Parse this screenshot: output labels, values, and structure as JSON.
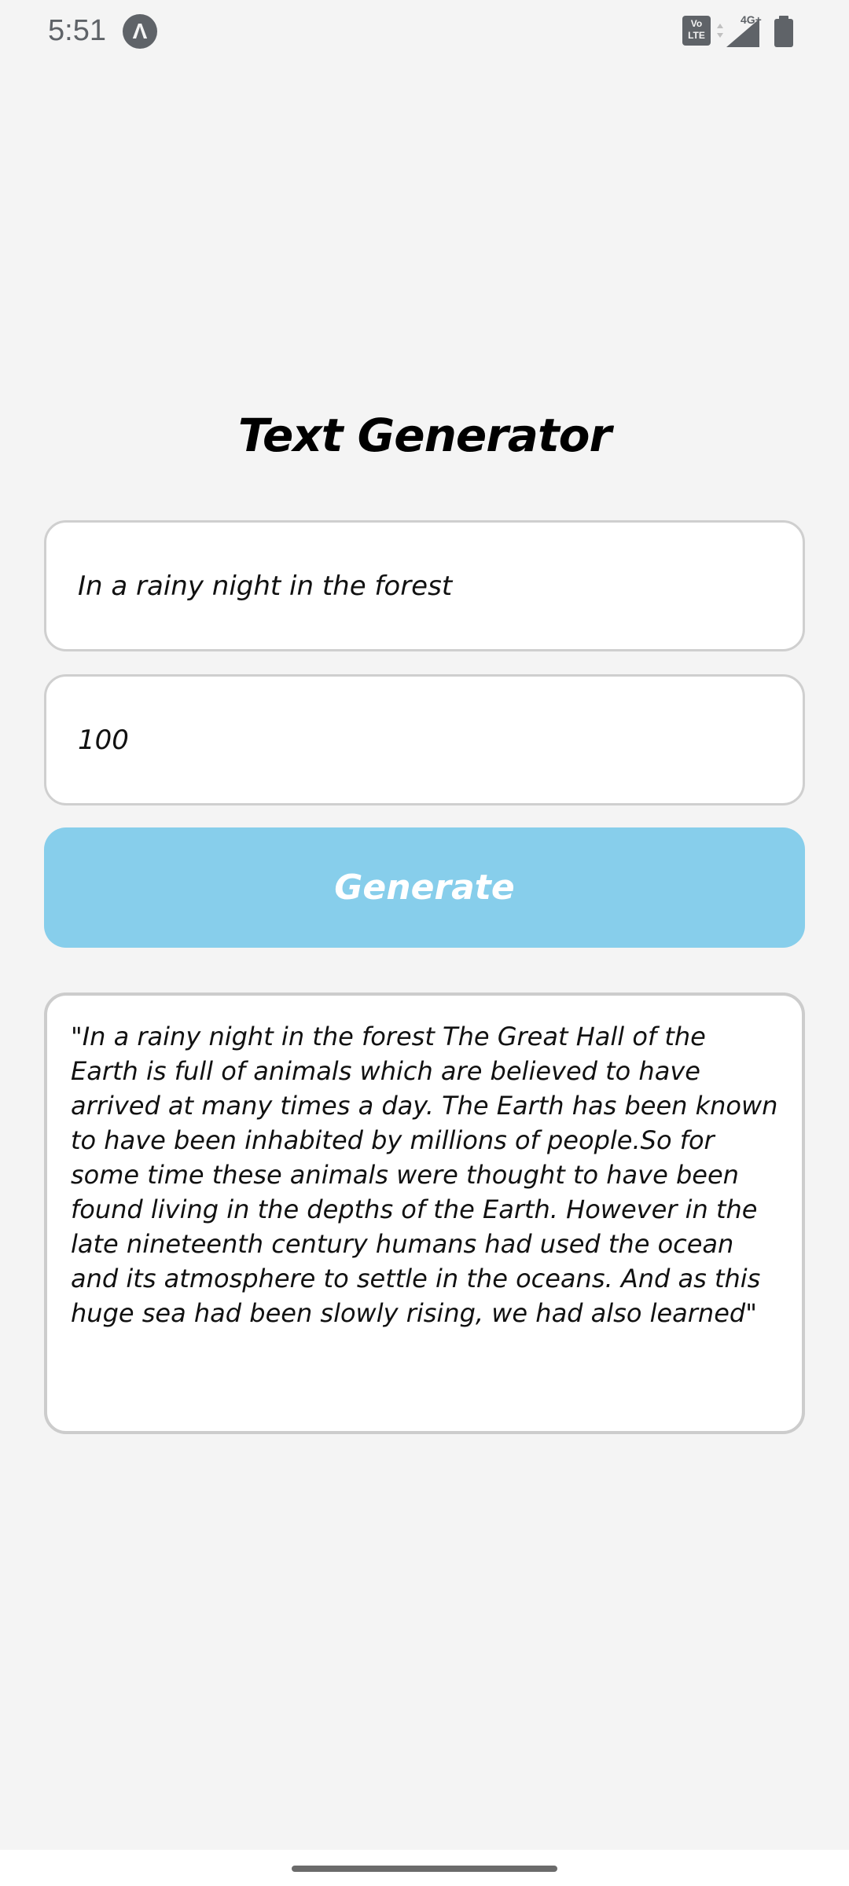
{
  "status_bar": {
    "time": "5:51",
    "app_icon_glyph": "Λ",
    "volte_label": "Vo\nLTE",
    "network_label": "4G+",
    "icon_color": "#5f6368"
  },
  "title": "Text Generator",
  "prompt_input": {
    "value": "In a rainy night in the forest"
  },
  "length_input": {
    "value": "100"
  },
  "generate_button": {
    "label": "Generate",
    "color": "#87ceeb"
  },
  "output": {
    "text": "\"In a rainy night in the forest   The Great Hall of the Earth is full of animals which are believed to have arrived at many times a day. The Earth has been known to have been inhabited by millions of people.So for some time these animals were thought to have been found living in the depths of the Earth. However in the late nineteenth century humans had used the ocean and its atmosphere to settle in the oceans. And as this huge sea had been slowly rising, we had also learned\""
  }
}
